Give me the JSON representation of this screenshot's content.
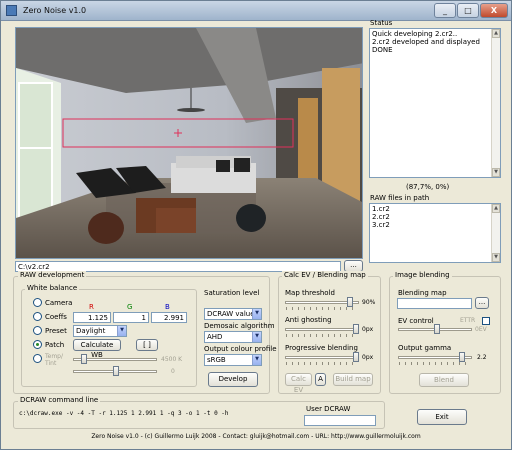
{
  "window": {
    "title": "Zero Noise v1.0",
    "minimize": "_",
    "maximize": "□",
    "close": "X"
  },
  "image": {
    "path": "C:\\v2.cr2",
    "browse": "..."
  },
  "status": {
    "label": "Status",
    "lines": [
      "Quick developing 2.cr2..",
      "2.cr2 developed and displayed",
      "DONE"
    ],
    "coords": "(87,7%, 0%)"
  },
  "raw_files": {
    "label": "RAW files in path",
    "items": [
      "1.cr2",
      "2.cr2",
      "3.cr2"
    ]
  },
  "raw_dev": {
    "label": "RAW development",
    "wb_label": "White balance",
    "camera": "Camera",
    "coeffs": "Coeffs",
    "preset": "Preset",
    "patch": "Patch",
    "temp": "Temp/\nTint",
    "r_label": "R",
    "g_label": "G",
    "b_label": "B",
    "r_val": "1.125",
    "g_val": "1",
    "b_val": "2.991",
    "preset_value": "Daylight",
    "calc_wb": "Calculate WB",
    "bracket": "[ ]",
    "temp_value": "4500 K",
    "tint_value": "0",
    "sat_label": "Saturation level",
    "sat_value": "DCRAW value",
    "demosaic_label": "Demosaic algorithm",
    "demosaic_value": "AHD",
    "profile_label": "Output colour profile",
    "profile_value": "sRGB",
    "develop": "Develop"
  },
  "calc_ev": {
    "label": "Calc EV / Blending map",
    "map_threshold": "Map threshold",
    "map_threshold_val": "90%",
    "anti_ghosting": "Anti ghosting",
    "anti_ghosting_val": "0px",
    "progressive": "Progressive blending",
    "progressive_val": "0px",
    "calc_ev": "Calc EV",
    "a": "A",
    "build_map": "Build map"
  },
  "blend": {
    "label": "Image blending",
    "map_label": "Blending map",
    "browse": "...",
    "ev_control": "EV control",
    "ettr": "ETTR",
    "ev_val": "0EV",
    "gamma_label": "Output gamma",
    "gamma_val": "2.2",
    "blend": "Blend"
  },
  "dcraw": {
    "label": "DCRAW command line",
    "command": "c:\\dcraw.exe -v -4 -T -r 1.125 1 2.991 1 -q 3 -o 1 -t 0 -h",
    "user_label": "User DCRAW"
  },
  "exit": "Exit",
  "footer": "Zero Noise v1.0 - (c) Guillermo Luijk 2008 - Contact: gluijk@hotmail.com - URL: http://www.guillermoluijk.com",
  "colors": {
    "r": "#d00000",
    "g": "#008000",
    "b": "#0000c0",
    "selection": "#e0305a"
  }
}
